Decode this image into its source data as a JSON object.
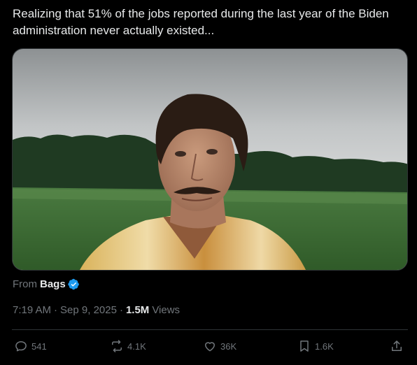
{
  "tweet": {
    "text": "Realizing that 51% of the jobs reported during the last year of the Biden administration never actually existed..."
  },
  "source": {
    "prefix": "From",
    "name": "Bags",
    "verified_icon": "verified-badge-icon"
  },
  "meta": {
    "time": "7:19 AM",
    "date": "Sep 9, 2025",
    "views_count": "1.5M",
    "views_label": "Views",
    "sep": "·"
  },
  "actions": {
    "replies": "541",
    "reposts": "4.1K",
    "likes": "36K",
    "bookmarks": "1.6K"
  },
  "icons": {
    "reply": "reply-icon",
    "repost": "repost-icon",
    "like": "heart-icon",
    "bookmark": "bookmark-icon",
    "share": "share-icon"
  },
  "colors": {
    "background": "#000000",
    "text_primary": "#e7e9ea",
    "text_secondary": "#71767b",
    "verified_blue": "#1d9bf0",
    "divider": "#2f3336"
  }
}
